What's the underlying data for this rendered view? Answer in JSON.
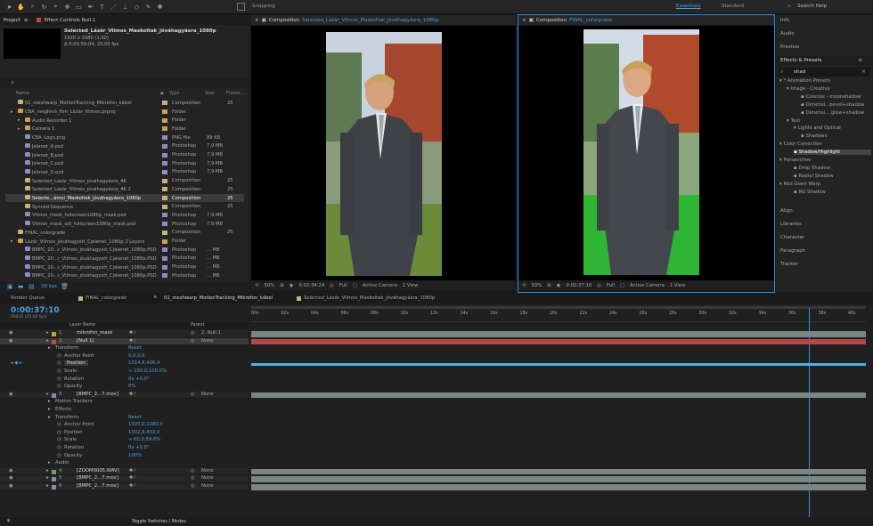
{
  "toolbar": {
    "snapping": "Snapping",
    "workspaces": [
      "Essentials",
      "Standard"
    ],
    "search": "Search Help"
  },
  "project": {
    "tabs": [
      "Project",
      "Effect Controls Null 1"
    ],
    "selected_name": "Selected_Lázár_Vilmos_Maskoltak_jóváhagyásra_1080p",
    "selected_info": [
      "1920 x 1080 (1,00)",
      "Δ 0:03:59:04, 25,00 fps"
    ],
    "columns": [
      "Name",
      "Type",
      "Size",
      "Frame ..."
    ],
    "items": [
      {
        "name": "01_meshwarp_MotionTracking_Mikrofon_kábel",
        "type": "Composition",
        "size": "",
        "fr": "25",
        "indent": 0,
        "icon": "comp"
      },
      {
        "name": "CBA_meghívó_film_Lázár_Vilmos.prproj",
        "type": "Folder",
        "size": "",
        "fr": "",
        "indent": 0,
        "icon": "folder"
      },
      {
        "name": "Audio Recorder 1",
        "type": "Folder",
        "size": "",
        "fr": "",
        "indent": 1,
        "icon": "folder"
      },
      {
        "name": "Camera 1",
        "type": "Folder",
        "size": "",
        "fr": "",
        "indent": 1,
        "icon": "folder"
      },
      {
        "name": "CBA_Logo.png",
        "type": "PNG file",
        "size": "89 KB",
        "fr": "",
        "indent": 1,
        "icon": "img"
      },
      {
        "name": "Jelenet_A.psd",
        "type": "Photoshop",
        "size": "7,9 MB",
        "fr": "",
        "indent": 1,
        "icon": "img"
      },
      {
        "name": "Jelenet_B.psd",
        "type": "Photoshop",
        "size": "7,9 MB",
        "fr": "",
        "indent": 1,
        "icon": "img"
      },
      {
        "name": "Jelenet_C.psd",
        "type": "Photoshop",
        "size": "7,9 MB",
        "fr": "",
        "indent": 1,
        "icon": "img"
      },
      {
        "name": "Jelenet_D.psd",
        "type": "Photoshop",
        "size": "7,9 MB",
        "fr": "",
        "indent": 1,
        "icon": "img"
      },
      {
        "name": "Selected_Lázár_Vilmos_jóváhagyásra_4K",
        "type": "Composition",
        "size": "",
        "fr": "25",
        "indent": 1,
        "icon": "comp"
      },
      {
        "name": "Selected_Lázár_Vilmos_jóváhagyásra_4K 2",
        "type": "Composition",
        "size": "",
        "fr": "25",
        "indent": 1,
        "icon": "comp"
      },
      {
        "name": "Selecte...ámoi_Maskoltak_jóváhagyásra_1080p",
        "type": "Composition",
        "size": "",
        "fr": "25",
        "indent": 1,
        "icon": "comp",
        "selected": true
      },
      {
        "name": "Synced Sequence",
        "type": "Composition",
        "size": "",
        "fr": "25",
        "indent": 1,
        "icon": "comp"
      },
      {
        "name": "Vilmos_mask_fullscreen1080p_mask.psd",
        "type": "Photoshop",
        "size": "7,9 MB",
        "fr": "",
        "indent": 1,
        "icon": "img"
      },
      {
        "name": "Vilmos_mask_söt_fullscreen1080p_mask.psd",
        "type": "Photoshop",
        "size": "7,9 MB",
        "fr": "",
        "indent": 1,
        "icon": "img"
      },
      {
        "name": "FINAL_colorgrade",
        "type": "Composition",
        "size": "",
        "fr": "25",
        "indent": 0,
        "icon": "comp"
      },
      {
        "name": "Lázár_Vilmos_jóváhagyott_Cjelenet_1080p 2 Layers",
        "type": "Folder",
        "size": "",
        "fr": "",
        "indent": 0,
        "icon": "folder"
      },
      {
        "name": "BMPC_20...r_Vilmos_jóváhagyott_Cjelenet_1080p.PSD",
        "type": "Photoshop",
        "size": "... MB",
        "fr": "",
        "indent": 1,
        "icon": "img"
      },
      {
        "name": "BMPC_20...r_Vilmos_jóváhagyott_Cjelenet_1080p.PSD",
        "type": "Photoshop",
        "size": "... MB",
        "fr": "",
        "indent": 1,
        "icon": "img"
      },
      {
        "name": "BMPC_20...r_Vilmos_jóváhagyott_Cjelenet_1080p.PSD",
        "type": "Photoshop",
        "size": "... MB",
        "fr": "",
        "indent": 1,
        "icon": "img"
      },
      {
        "name": "BMPC_20...r_Vilmos_jóváhagyott_Cjelenet_1080p.PSD",
        "type": "Photoshop",
        "size": "... MB",
        "fr": "",
        "indent": 1,
        "icon": "img"
      }
    ],
    "bpc": "16 bpc"
  },
  "viewer_left": {
    "label": "Composition",
    "comp_name": "Selected_Lázár_Vilmos_Maskoltak_jóváhagyásra_1080p",
    "zoom": "50%",
    "time": "0:02:34:24",
    "res": "Full",
    "camera": "Active Camera",
    "view": "1 View"
  },
  "viewer_right": {
    "label": "Composition",
    "comp_name": "FINAL_colorgrade",
    "zoom": "50%",
    "time": "0:00:37:10",
    "res": "Full",
    "camera": "Active Camera",
    "view": "1 View"
  },
  "right_panel": {
    "headers": [
      "Info",
      "Audio",
      "Preview"
    ],
    "effects_title": "Effects & Presets",
    "search_value": "shad",
    "tree": [
      {
        "label": "* Animation Presets",
        "indent": 0
      },
      {
        "label": "Image - Creative",
        "indent": 1
      },
      {
        "label": "Colorize - moonshadow",
        "indent": 3
      },
      {
        "label": "Dimensi...bevel+shadow",
        "indent": 3
      },
      {
        "label": "Dimensi... glow+shadow",
        "indent": 3
      },
      {
        "label": "Text",
        "indent": 1
      },
      {
        "label": "Lights and Optical",
        "indent": 2
      },
      {
        "label": "Shadows",
        "indent": 3
      },
      {
        "label": "Color Correction",
        "indent": 0
      },
      {
        "label": "Shadow/Highlight",
        "indent": 2,
        "selected": true
      },
      {
        "label": "Perspective",
        "indent": 0
      },
      {
        "label": "Drop Shadow",
        "indent": 2
      },
      {
        "label": "Radial Shadow",
        "indent": 2
      },
      {
        "label": "Red Giant Warp",
        "indent": 0
      },
      {
        "label": "RG Shadow",
        "indent": 2
      }
    ],
    "lower": [
      "Align",
      "Libraries",
      "Character",
      "Paragraph",
      "Tracker"
    ]
  },
  "timeline": {
    "tabs": [
      "Render Queue",
      "FINAL_colorgrade",
      "01_meshwarp_MotionTracking_Mikrofon_kábel",
      "Selected_Lázár_Vilmos_Maskoltak_jóváhagyásra_1080p"
    ],
    "timecode": "0:00:37:10",
    "timecode_sub": "00935 (25.00 fps)",
    "col_headers": [
      "Layer Name",
      "Parent"
    ],
    "ruler": [
      "00s",
      "02s",
      "04s",
      "06s",
      "08s",
      "10s",
      "12s",
      "14s",
      "16s",
      "18s",
      "20s",
      "22s",
      "24s",
      "26s",
      "28s",
      "30s",
      "32s",
      "34s",
      "36s",
      "38s",
      "40s"
    ],
    "playhead_seconds": 37.4,
    "rows": [
      {
        "kind": "layer",
        "num": "1",
        "name": "mikrofon_mask",
        "parent": "2. Null 1",
        "color": "#b7a43a",
        "bar": "#7a8686"
      },
      {
        "kind": "layer",
        "num": "2",
        "name": "[Null 1]",
        "parent": "None",
        "color": "#c44a4a",
        "bar": "#b24848",
        "selected": true
      },
      {
        "kind": "group",
        "name": "Transform",
        "value": "Reset",
        "level": 1
      },
      {
        "kind": "prop",
        "name": "Anchor Point",
        "value": "0,0,0,0",
        "level": 2
      },
      {
        "kind": "prop",
        "name": "Position",
        "value": "1014,8,426,4",
        "level": 2,
        "keyed": true
      },
      {
        "kind": "prop",
        "name": "Scale",
        "value": "∞ 100,0,100,0%",
        "level": 2
      },
      {
        "kind": "prop",
        "name": "Rotation",
        "value": "0x +0,0°",
        "level": 2
      },
      {
        "kind": "prop",
        "name": "Opacity",
        "value": "0%",
        "level": 2
      },
      {
        "kind": "layer",
        "num": "3",
        "name": "[BMPC_2...7.mov]",
        "parent": "None",
        "color": "#7a8fb0",
        "bar": "#7a8686"
      },
      {
        "kind": "group",
        "name": "Motion Trackers",
        "value": "",
        "level": 1
      },
      {
        "kind": "group",
        "name": "Effects",
        "value": "",
        "level": 1
      },
      {
        "kind": "group",
        "name": "Transform",
        "value": "Reset",
        "level": 1
      },
      {
        "kind": "prop",
        "name": "Anchor Point",
        "value": "1920,0,1080,0",
        "level": 2
      },
      {
        "kind": "prop",
        "name": "Position",
        "value": "1002,8,402,0",
        "level": 2
      },
      {
        "kind": "prop",
        "name": "Scale",
        "value": "∞ 60,0,59,6%",
        "level": 2
      },
      {
        "kind": "prop",
        "name": "Rotation",
        "value": "0x +0,0°",
        "level": 2
      },
      {
        "kind": "prop",
        "name": "Opacity",
        "value": "100%",
        "level": 2
      },
      {
        "kind": "group",
        "name": "Audio",
        "value": "",
        "level": 1
      },
      {
        "kind": "layer",
        "num": "4",
        "name": "[ZOOM0005.WAV]",
        "parent": "None",
        "color": "#6fa36f",
        "bar": "#7a8686"
      },
      {
        "kind": "layer",
        "num": "5",
        "name": "[BMPC_2...7.mov]",
        "parent": "None",
        "color": "#7a8fb0",
        "bar": "#7a8686"
      },
      {
        "kind": "layer",
        "num": "6",
        "name": "[BMPC_2...7.mov]",
        "parent": "None",
        "color": "#7a8fb0",
        "bar": "#7a8686"
      }
    ],
    "footer": "Toggle Switches / Modes"
  },
  "colors": {
    "accent": "#2d8ceb",
    "comp": "#c8b27a",
    "folder": "#c9a24e",
    "img": "#8c8cc8",
    "keyframe_line": "#4fb2ea"
  }
}
